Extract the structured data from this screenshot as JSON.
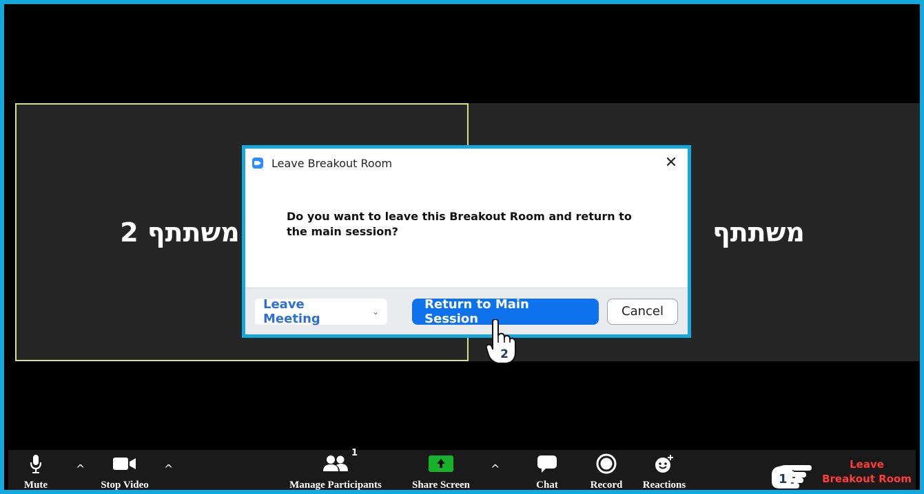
{
  "participants": {
    "left_name": "משתתף 2",
    "right_name": "משתתף"
  },
  "dialog": {
    "title": "Leave Breakout Room",
    "close_glyph": "✕",
    "message": "Do you want to leave this Breakout Room and return to the main session?",
    "leave_meeting_label": "Leave Meeting",
    "leave_meeting_chevron": "⌄",
    "return_label": "Return to Main Session",
    "cancel_label": "Cancel"
  },
  "annotations": {
    "step1": "1",
    "step2": "2"
  },
  "toolbar": {
    "mute_label": "Mute",
    "caret_glyph": "^",
    "stop_video_label": "Stop Video",
    "participants_label": "Manage Participants",
    "participants_count": "1",
    "share_label": "Share Screen",
    "chat_label": "Chat",
    "record_label": "Record",
    "reactions_label": "Reactions",
    "leave_line1": "Leave",
    "leave_line2": "Breakout Room"
  },
  "colors": {
    "frame_border": "#13a9dc",
    "primary_button": "#0e72ed",
    "share_green": "#17b12b",
    "leave_red": "#ff3b3b",
    "active_speaker_border": "#d6e090"
  },
  "icons": [
    "microphone-icon",
    "video-camera-icon",
    "participants-icon",
    "share-screen-icon",
    "chat-icon",
    "record-icon",
    "reactions-icon",
    "pointing-hand-icon",
    "cursor-hand-icon",
    "zoom-logo-icon",
    "close-icon"
  ]
}
